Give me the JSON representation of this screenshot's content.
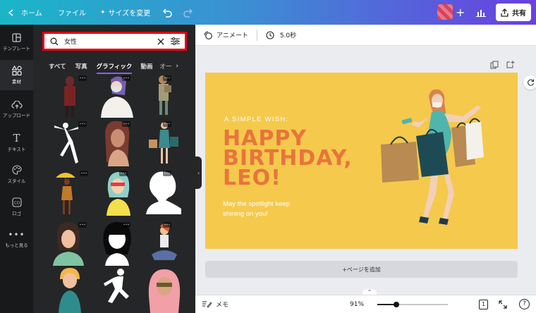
{
  "topbar": {
    "home_label": "ホーム",
    "file_label": "ファイル",
    "resize_label": "サイズを変更",
    "share_label": "共有"
  },
  "rail": {
    "items": [
      {
        "label": "テンプレート"
      },
      {
        "label": "素材"
      },
      {
        "label": "アップロード"
      },
      {
        "label": "テキスト"
      },
      {
        "label": "スタイル"
      },
      {
        "label": "ロゴ"
      },
      {
        "label": "もっと見る"
      }
    ]
  },
  "panel": {
    "search_value": "女性",
    "tabs": [
      "すべて",
      "写真",
      "グラフィック",
      "動画",
      "オー"
    ],
    "active_tab": "グラフィック"
  },
  "toolbar": {
    "animate_label": "アニメート",
    "duration_label": "5.0秒"
  },
  "design": {
    "kicker": "A SIMPLE WISH:",
    "line1": "HAPPY",
    "line2": "BIRTHDAY,",
    "line3": "LEO!",
    "message1": "May the spotlight keep",
    "message2": "shining on you!",
    "background_color": "#f5c94c",
    "headline_color": "#e8743c"
  },
  "add_page_label": "+ページを追加",
  "bottombar": {
    "notes_label": "メモ",
    "zoom_label": "91%",
    "zoom_value": 91,
    "page_number": "1"
  }
}
